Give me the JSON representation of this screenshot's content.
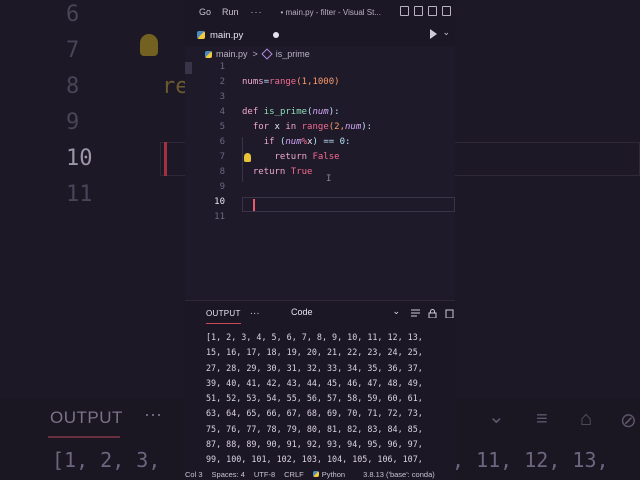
{
  "background": {
    "line_numbers": [
      "6",
      "7",
      "8",
      "9",
      "10",
      "11"
    ],
    "code_fragment": "re",
    "output_label": "OUTPUT",
    "output_dots": "···",
    "output_text": "[1, 2, 3,",
    "output_text_right": ", 11, 12, 13,"
  },
  "titlebar": {
    "menu_go": "Go",
    "menu_run": "Run",
    "menu_more": "···",
    "title": "• main.py - filter - Visual St..."
  },
  "tab": {
    "label": "main.py",
    "dirty_indicator": "●"
  },
  "breadcrumb": {
    "file": "main.py",
    "separator": ">",
    "symbol": "is_prime"
  },
  "editor": {
    "line_numbers": [
      "1",
      "2",
      "3",
      "4",
      "5",
      "6",
      "7",
      "8",
      "9",
      "10",
      "11"
    ],
    "active_line": "10",
    "code": {
      "l2_var": "nums",
      "l2_eq": "=",
      "l2_fn": "range",
      "l2_args": "(1,1000)",
      "l4_def": "def",
      "l4_name": "is_prime",
      "l4_open": "(",
      "l4_param": "num",
      "l4_close": "):",
      "l5_for": "for",
      "l5_x": "x",
      "l5_in": "in",
      "l5_range": "range",
      "l5_args_open": "(2,",
      "l5_param": "num",
      "l5_args_close": "):",
      "l6_if": "if",
      "l6_open": "(",
      "l6_param": "num",
      "l6_mod": "%",
      "l6_x": "x",
      "l6_rest": ") == 0:",
      "l7_return": "return",
      "l7_val": "False",
      "l8_return": "return",
      "l8_val": "True"
    }
  },
  "panel": {
    "tab_output": "OUTPUT",
    "more": "···",
    "channel": "Code",
    "output_lines": [
      "[1, 2, 3, 4, 5, 6, 7, 8, 9, 10, 11, 12, 13,",
      "15, 16, 17, 18, 19, 20, 21, 22, 23, 24, 25,",
      "27, 28, 29, 30, 31, 32, 33, 34, 35, 36, 37,",
      "39, 40, 41, 42, 43, 44, 45, 46, 47, 48, 49,",
      "51, 52, 53, 54, 55, 56, 57, 58, 59, 60, 61,",
      "63, 64, 65, 66, 67, 68, 69, 70, 71, 72, 73,",
      "75, 76, 77, 78, 79, 80, 81, 82, 83, 84, 85,",
      "87, 88, 89, 90, 91, 92, 93, 94, 95, 96, 97,",
      "99, 100, 101, 102, 103, 104, 105, 106, 107,"
    ]
  },
  "statusbar": {
    "col": "Col 3",
    "spaces": "Spaces: 4",
    "encoding": "UTF-8",
    "eol": "CRLF",
    "language": "Python",
    "interpreter": "3.8.13 ('base': conda)"
  },
  "colors": {
    "keyword": "#f0a8cf",
    "function": "#8fdcb8",
    "number": "#f79a6a",
    "parameter": "#d3a8f7",
    "builtin_const": "#f46a8f",
    "accent_underline": "#c74a5c"
  }
}
